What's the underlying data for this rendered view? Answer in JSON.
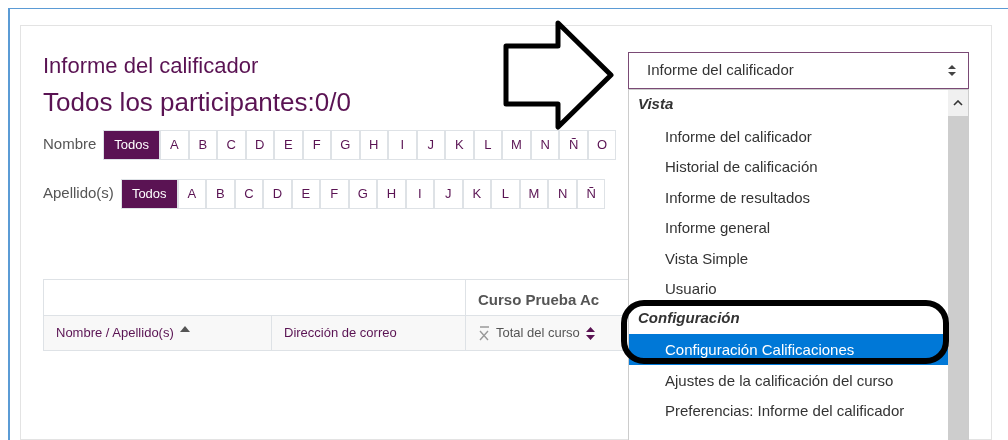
{
  "heading": "Informe del calificador",
  "subheading": "Todos los participantes:0/0",
  "filters": [
    {
      "label": "Nombre",
      "letters": [
        {
          "text": "Todos",
          "selected": true
        },
        {
          "text": "A",
          "selected": false
        },
        {
          "text": "B",
          "selected": false
        },
        {
          "text": "C",
          "selected": false
        },
        {
          "text": "D",
          "selected": false
        },
        {
          "text": "E",
          "selected": false
        },
        {
          "text": "F",
          "selected": false
        },
        {
          "text": "G",
          "selected": false
        },
        {
          "text": "H",
          "selected": false
        },
        {
          "text": "I",
          "selected": false
        },
        {
          "text": "J",
          "selected": false
        },
        {
          "text": "K",
          "selected": false
        },
        {
          "text": "L",
          "selected": false
        },
        {
          "text": "M",
          "selected": false
        },
        {
          "text": "N",
          "selected": false
        },
        {
          "text": "Ñ",
          "selected": false
        },
        {
          "text": "O",
          "selected": false
        }
      ]
    },
    {
      "label": "Apellido(s)",
      "letters": [
        {
          "text": "Todos",
          "selected": true
        },
        {
          "text": "A",
          "selected": false
        },
        {
          "text": "B",
          "selected": false
        },
        {
          "text": "C",
          "selected": false
        },
        {
          "text": "D",
          "selected": false
        },
        {
          "text": "E",
          "selected": false
        },
        {
          "text": "F",
          "selected": false
        },
        {
          "text": "G",
          "selected": false
        },
        {
          "text": "H",
          "selected": false
        },
        {
          "text": "I",
          "selected": false
        },
        {
          "text": "J",
          "selected": false
        },
        {
          "text": "K",
          "selected": false
        },
        {
          "text": "L",
          "selected": false
        },
        {
          "text": "M",
          "selected": false
        },
        {
          "text": "N",
          "selected": false
        },
        {
          "text": "Ñ",
          "selected": false
        }
      ]
    }
  ],
  "table": {
    "group_header": "Curso Prueba Ac",
    "columns": [
      {
        "label": "Nombre / Apellido(s)",
        "kind": "sorted"
      },
      {
        "label": "Dirección de correo",
        "kind": "plain"
      },
      {
        "label": "Total del curso",
        "kind": "aggregate"
      }
    ]
  },
  "report_select": {
    "value": "Informe del calificador",
    "groups": [
      {
        "label": "Vista",
        "items": [
          {
            "label": "Informe del calificador",
            "selected": false
          },
          {
            "label": "Historial de calificación",
            "selected": false
          },
          {
            "label": "Informe de resultados",
            "selected": false
          },
          {
            "label": "Informe general",
            "selected": false
          },
          {
            "label": "Vista Simple",
            "selected": false
          },
          {
            "label": "Usuario",
            "selected": false
          }
        ]
      },
      {
        "label": "Configuración",
        "items": [
          {
            "label": "Configuración Calificaciones",
            "selected": true
          },
          {
            "label": "Ajustes de la calificación del curso",
            "selected": false
          },
          {
            "label": "Preferencias: Informe del calificador",
            "selected": false
          }
        ]
      }
    ]
  }
}
